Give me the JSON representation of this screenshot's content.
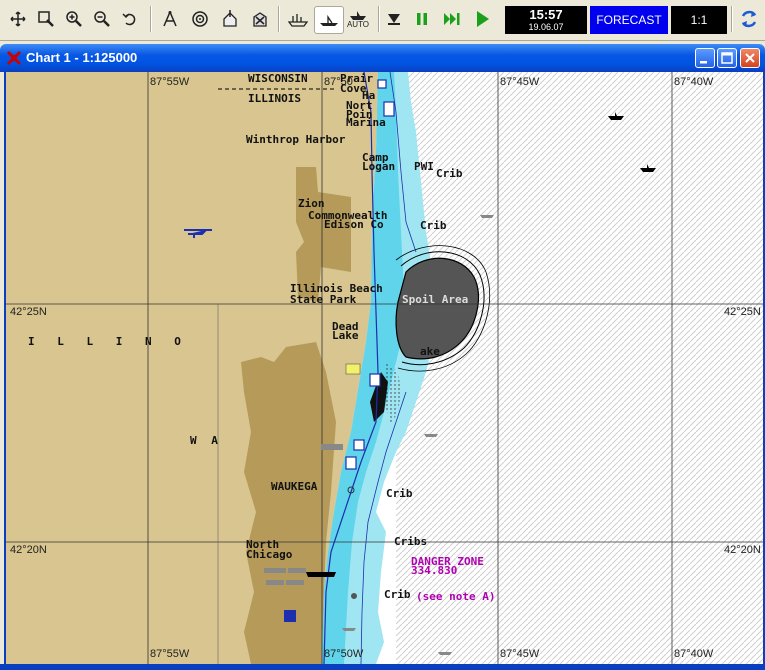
{
  "toolbar": {
    "buttons": [
      {
        "name": "fit-icon"
      },
      {
        "name": "zoom-window-icon"
      },
      {
        "name": "zoom-in-icon"
      },
      {
        "name": "zoom-out-icon"
      },
      {
        "name": "undo-icon"
      },
      {
        "name": "compass-icon"
      },
      {
        "name": "target-icon"
      },
      {
        "name": "home-icon"
      },
      {
        "name": "route-icon"
      },
      {
        "name": "ship-icon"
      },
      {
        "name": "boat-icon"
      },
      {
        "name": "auto-ship-icon"
      },
      {
        "name": "stop-icon"
      },
      {
        "name": "pause-icon"
      },
      {
        "name": "fast-forward-icon"
      },
      {
        "name": "play-icon"
      }
    ],
    "auto_label": "AUTO",
    "clock_time": "15:57",
    "clock_date": "19.06.07",
    "forecast_label": "FORECAST",
    "scale_label": "1:1"
  },
  "window": {
    "title": "Chart 1 - 1:125000"
  },
  "chart": {
    "grid_labels": {
      "top": [
        "87°55W",
        "87°45W",
        "87°40W"
      ],
      "top_partial": "87°50",
      "bottom": [
        "87°55W",
        "87°50W",
        "87°45W",
        "87°40W"
      ],
      "left": [
        "42°25N",
        "42°20N"
      ],
      "right": [
        "42°25N",
        "42°20N"
      ]
    },
    "labels": {
      "wisconsin": "WISCONSIN",
      "illinois": "ILLINOIS",
      "prairie": "Prair",
      "cove": "Cove",
      "ha": "Ha",
      "nort": "Nort",
      "poin": "Poin",
      "marina": "Marina",
      "winthrop": "Winthrop Harbor",
      "camp": "Camp",
      "logan": "Logan",
      "pwi": "PWI",
      "crib1": "Crib",
      "zion": "Zion",
      "commonwealth": "Commonwealth",
      "edison": "Edison Co",
      "crib2": "Crib",
      "illinois_beach": "Illinois Beach",
      "state_park": "State Park",
      "spoil": "Spoil Area",
      "dead": "Dead",
      "lake": "Lake",
      "lake2": "ake",
      "illino_spread": "I  L  L  I  N  O",
      "wa": "W A",
      "waukegan": "WAUKEGA",
      "crib3": "Crib",
      "north": "North",
      "chicago": "Chicago",
      "cribs": "Cribs",
      "danger": "DANGER ZONE",
      "danger_num": "334.830",
      "crib4": "Crib",
      "see_note": "(see note A)"
    }
  }
}
